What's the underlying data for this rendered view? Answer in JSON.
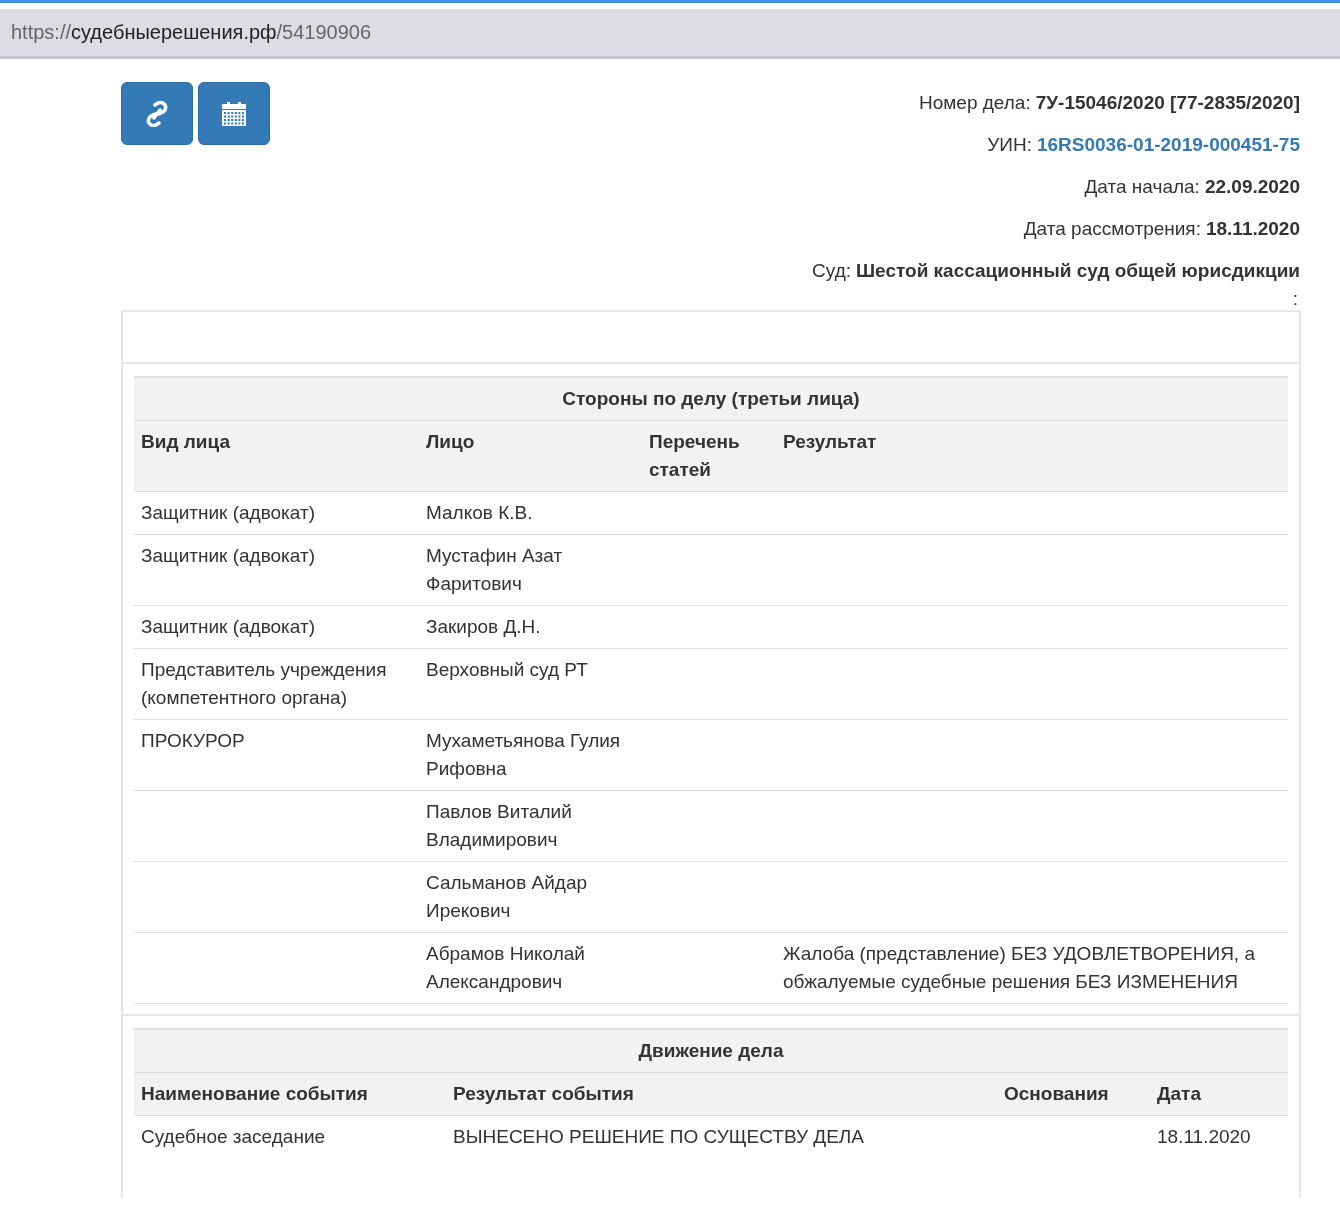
{
  "address_bar": {
    "scheme": "https://",
    "host": "судебныерешения.рф",
    "path": "/54190906"
  },
  "toolbar": {
    "buttons": [
      {
        "kind": "link"
      },
      {
        "kind": "calendar"
      }
    ]
  },
  "case_info": [
    {
      "label": "Номер дела:",
      "value": "7У-15046/2020 [77-2835/2020]",
      "kind": "text"
    },
    {
      "label": "УИН:",
      "value": "16RS0036-01-2019-000451-75",
      "kind": "link"
    },
    {
      "label": "Дата начала:",
      "value": "22.09.2020",
      "kind": "text"
    },
    {
      "label": "Дата рассмотрения:",
      "value": "18.11.2020",
      "kind": "text"
    },
    {
      "label": "Суд:",
      "value": "Шестой кассационный суд общей юрисдикции",
      "kind": "text"
    }
  ],
  "trailing_mark": ":",
  "parties": {
    "title": "Стороны по делу (третьи лица)",
    "columns": [
      "Вид лица",
      "Лицо",
      "Перечень статей",
      "Результат"
    ],
    "rows": [
      [
        "Защитник (адвокат)",
        "Малков К.В.",
        "",
        ""
      ],
      [
        "Защитник (адвокат)",
        "Мустафин Азат Фаритович",
        "",
        ""
      ],
      [
        "Защитник (адвокат)",
        "Закиров Д.Н.",
        "",
        ""
      ],
      [
        "Представитель учреждения (компетентного органа)",
        "Верховный суд РТ",
        "",
        ""
      ],
      [
        "ПРОКУРОР",
        "Мухаметьянова Гулия Рифовна",
        "",
        ""
      ],
      [
        "",
        "Павлов Виталий Владимирович",
        "",
        ""
      ],
      [
        "",
        "Сальманов Айдар Ирекович",
        "",
        ""
      ],
      [
        "",
        "Абрамов Николай Александрович",
        "",
        "Жалоба (представление) БЕЗ УДОВЛЕТВОРЕНИЯ, а обжалуемые судебные решения БЕЗ ИЗМЕНЕНИЯ"
      ]
    ]
  },
  "movement": {
    "title": "Движение дела",
    "columns": [
      "Наименование события",
      "Результат события",
      "Основания",
      "Дата"
    ],
    "rows": [
      [
        "Судебное заседание",
        "ВЫНЕСЕНО РЕШЕНИЕ ПО СУЩЕСТВУ ДЕЛА",
        "",
        "18.11.2020"
      ]
    ]
  }
}
